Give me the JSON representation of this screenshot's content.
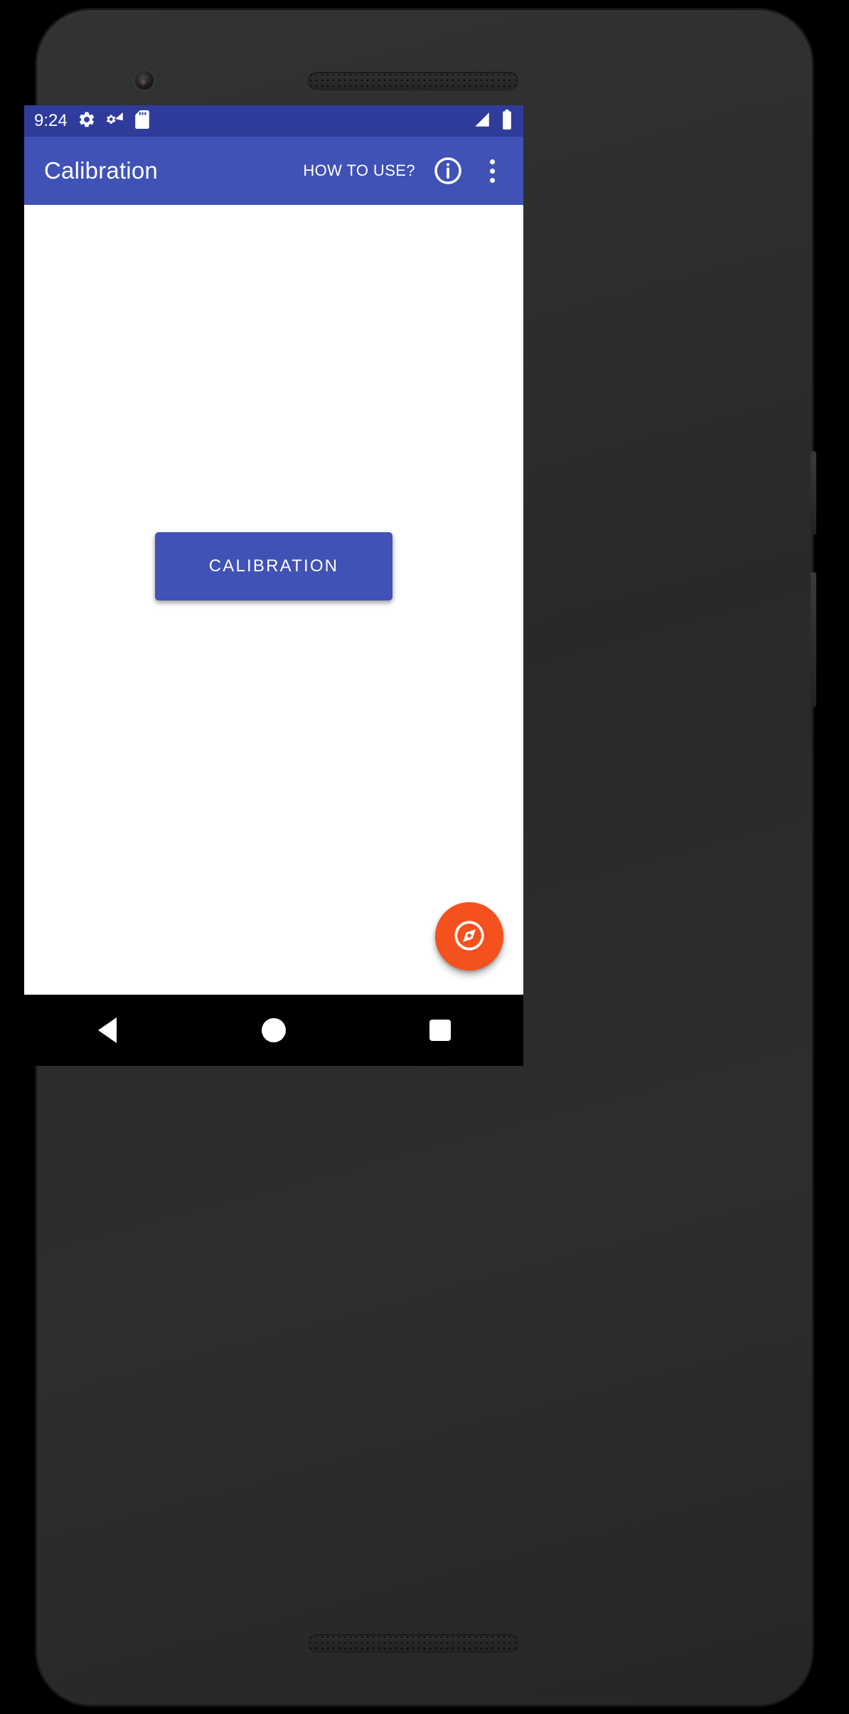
{
  "device": {
    "camera_icon": "front-camera-icon",
    "earpiece_icon": "earpiece-speaker-grille",
    "bottom_speaker_icon": "bottom-speaker-grille"
  },
  "status_bar": {
    "clock": "9:24",
    "background_color": "#2f3c9c",
    "left_icons": [
      {
        "name": "settings-gear-icon"
      },
      {
        "name": "settings-wifi-icon"
      },
      {
        "name": "sd-card-icon"
      }
    ],
    "right_icons": [
      {
        "name": "cellular-signal-icon"
      },
      {
        "name": "battery-full-icon"
      }
    ]
  },
  "app_bar": {
    "title": "Calibration",
    "how_to_use_label": "HOW TO USE?",
    "info_icon": "info-circle-icon",
    "overflow_icon": "more-vert-icon",
    "background_color": "#4052b5",
    "text_color": "#ffffff"
  },
  "content": {
    "calibration_button_label": "CALIBRATION",
    "calibration_button_color": "#4052b5",
    "fab": {
      "icon": "compass-explore-icon",
      "color": "#f4511e"
    },
    "background_color": "#ffffff"
  },
  "nav_bar": {
    "background_color": "#000000",
    "buttons": [
      {
        "name": "back-button",
        "icon": "back-triangle-icon"
      },
      {
        "name": "home-button",
        "icon": "home-circle-icon"
      },
      {
        "name": "recents-button",
        "icon": "recents-square-icon"
      }
    ]
  }
}
